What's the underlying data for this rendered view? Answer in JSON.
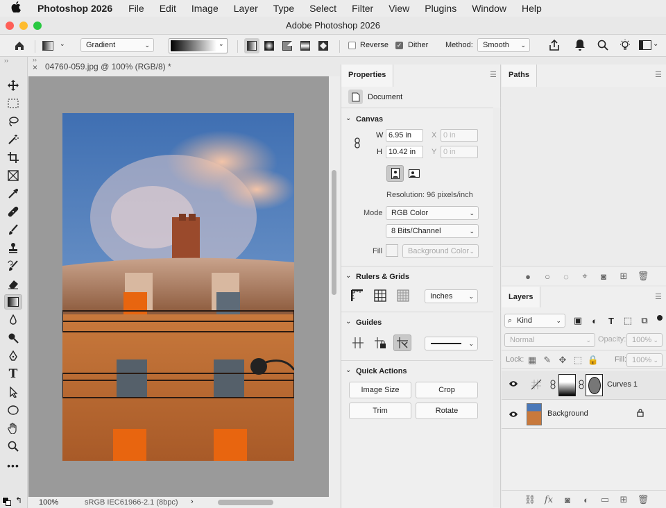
{
  "menubar": {
    "apple": "",
    "app": "Photoshop 2026",
    "items": [
      "File",
      "Edit",
      "Image",
      "Layer",
      "Type",
      "Select",
      "Filter",
      "View",
      "Plugins",
      "Window",
      "Help"
    ]
  },
  "window": {
    "title": "Adobe Photoshop 2026"
  },
  "options": {
    "mode_dropdown": "Gradient",
    "reverse_label": "Reverse",
    "reverse_checked": false,
    "dither_label": "Dither",
    "dither_checked": true,
    "method_label": "Method:",
    "method_value": "Smooth"
  },
  "document": {
    "tab_title": "04760-059.jpg @ 100% (RGB/8) *",
    "zoom": "100%",
    "color_profile": "sRGB IEC61966-2.1 (8bpc)"
  },
  "properties": {
    "tab": "Properties",
    "doc_label": "Document",
    "canvas": {
      "title": "Canvas",
      "w_label": "W",
      "w_value": "6.95 in",
      "h_label": "H",
      "h_value": "10.42 in",
      "x_label": "X",
      "x_placeholder": "0 in",
      "y_label": "Y",
      "y_placeholder": "0 in",
      "resolution": "Resolution: 96 pixels/inch",
      "mode_label": "Mode",
      "mode_value": "RGB Color",
      "bits_value": "8 Bits/Channel",
      "fill_label": "Fill",
      "fill_value": "Background Color"
    },
    "rulers": {
      "title": "Rulers & Grids",
      "units": "Inches"
    },
    "guides": {
      "title": "Guides"
    },
    "quick": {
      "title": "Quick Actions",
      "buttons": [
        "Image Size",
        "Crop",
        "Trim",
        "Rotate"
      ]
    }
  },
  "paths": {
    "tab": "Paths"
  },
  "layers": {
    "tab": "Layers",
    "filter_kind": "Kind",
    "blend_mode": "Normal",
    "opacity_label": "Opacity:",
    "opacity_value": "100%",
    "lock_label": "Lock:",
    "fill_label": "Fill:",
    "fill_value": "100%",
    "items": [
      {
        "name": "Curves 1"
      },
      {
        "name": "Background"
      }
    ]
  },
  "colors": {
    "accent": "#2e6fd8",
    "window_orange": "#e86a10",
    "sky": "#4a78b8"
  }
}
